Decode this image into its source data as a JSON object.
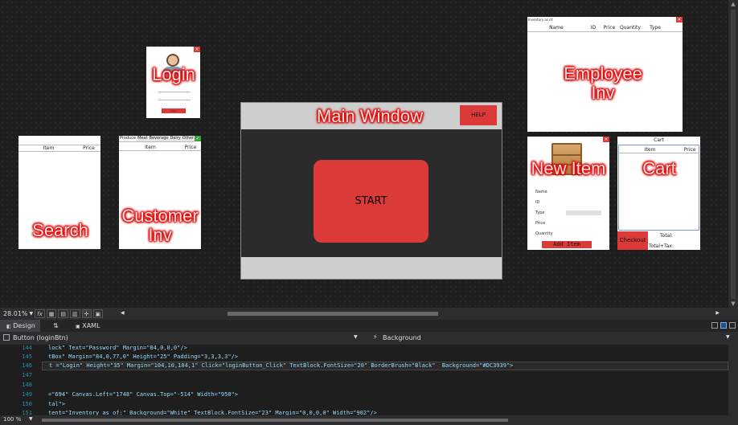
{
  "canvas": {
    "login_window": {
      "label": "Login",
      "button_label": "Login"
    },
    "search_window": {
      "label": "Search",
      "columns": [
        "Item",
        "Price"
      ]
    },
    "customer_inv_window": {
      "label": "Customer\nInv",
      "tabs": [
        "Produce",
        "Meat",
        "Beverage",
        "Dairy",
        "Other"
      ],
      "columns": [
        "Item",
        "Price"
      ]
    },
    "main_window": {
      "label": "Main Window",
      "help_label": "HELP",
      "start_label": "START"
    },
    "employee_inv_window": {
      "label": "Employee\nInv",
      "title": "Inventory as of:",
      "columns": [
        "Name",
        "ID",
        "Price",
        "Quantity",
        "Type"
      ]
    },
    "new_item_window": {
      "label": "New Item",
      "fields": [
        "Name",
        "ID",
        "Type",
        "Price",
        "Quantity"
      ],
      "add_label": "Add Item"
    },
    "cart_window": {
      "label": "Cart",
      "title": "Cart",
      "columns": [
        "Item",
        "Price"
      ],
      "checkout_label": "Checkout",
      "total_label": "Total:",
      "total_tax_label": "Total+Tax:"
    }
  },
  "status_bar": {
    "zoom": "28.01%",
    "fx": "fx"
  },
  "view_tabs": {
    "design": "Design",
    "swap": "⇅",
    "xaml": "XAML"
  },
  "breadcrumb": {
    "element": "Button (loginBtn)",
    "property": "Background"
  },
  "editor": {
    "lines": [
      {
        "num": "144",
        "text": "lock\" Text=\"Password\" Margin=\"84,0,0,0\"/>"
      },
      {
        "num": "145",
        "text": "tBox\" Margin=\"84,0,77,0\" Height=\"25\" Padding=\"3,3,3,3\"/>"
      },
      {
        "num": "146",
        "text": "t =\"Login\" Height=\"35\" Margin=\"104,10,104,1\" Click=\"loginButton_Click\" TextBlock.FontSize=\"20\" BorderBrush=\"Black\"  Background=\"#DC3939\">"
      },
      {
        "num": "147",
        "text": ""
      },
      {
        "num": "148",
        "text": ""
      },
      {
        "num": "149",
        "text": "=\"694\" Canvas.Left=\"1748\" Canvas.Top=\"-514\" Width=\"950\">"
      },
      {
        "num": "150",
        "text": "tal\">"
      },
      {
        "num": "151",
        "text": "tent=\"Inventory as of:\" Background=\"White\" TextBlock.FontSize=\"23\" Margin=\"0,0,0,0\" Width=\"902\"/>"
      }
    ]
  },
  "bottom_bar": {
    "zoom": "100 %"
  },
  "colors": {
    "accent_red": "#DC3939",
    "canvas_bg": "#1e1e1e",
    "green_close": "#3aa13a"
  }
}
